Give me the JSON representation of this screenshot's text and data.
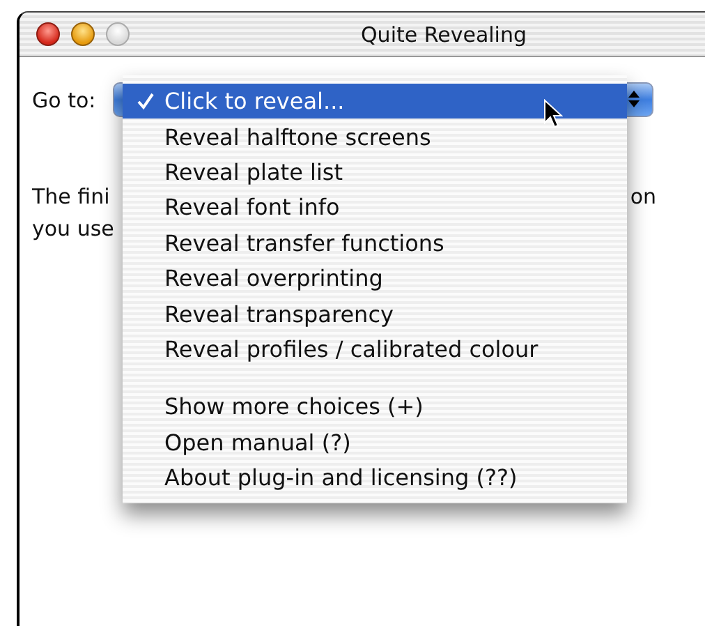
{
  "window": {
    "title": "Quite Revealing"
  },
  "goto": {
    "label": "Go to:"
  },
  "paragraph": [
    {
      "left": "The fini",
      "right": "on"
    },
    {
      "left": "you use"
    }
  ],
  "menu": {
    "items": [
      {
        "kind": "item",
        "label": "Click to reveal...",
        "selected": true,
        "checked": true
      },
      {
        "kind": "item",
        "label": "Reveal halftone screens",
        "selected": false,
        "checked": false
      },
      {
        "kind": "item",
        "label": "Reveal plate list",
        "selected": false,
        "checked": false
      },
      {
        "kind": "item",
        "label": "Reveal font info",
        "selected": false,
        "checked": false
      },
      {
        "kind": "item",
        "label": "Reveal transfer functions",
        "selected": false,
        "checked": false
      },
      {
        "kind": "item",
        "label": "Reveal overprinting",
        "selected": false,
        "checked": false
      },
      {
        "kind": "item",
        "label": "Reveal transparency",
        "selected": false,
        "checked": false
      },
      {
        "kind": "item",
        "label": "Reveal profiles / calibrated colour",
        "selected": false,
        "checked": false
      },
      {
        "kind": "separator"
      },
      {
        "kind": "item",
        "label": "Show more choices (+)",
        "selected": false,
        "checked": false
      },
      {
        "kind": "item",
        "label": "Open manual (?)",
        "selected": false,
        "checked": false
      },
      {
        "kind": "item",
        "label": "About plug-in and licensing (??)",
        "selected": false,
        "checked": false
      }
    ]
  }
}
